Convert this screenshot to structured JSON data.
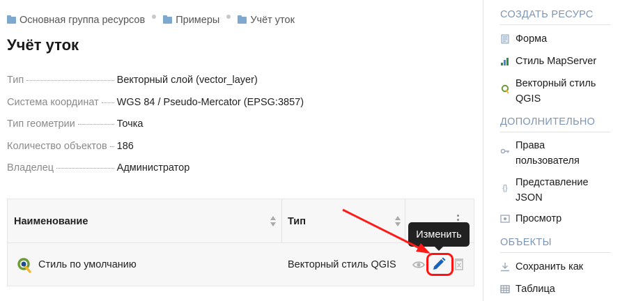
{
  "breadcrumb": [
    {
      "label": "Основная группа ресурсов"
    },
    {
      "label": "Примеры"
    },
    {
      "label": "Учёт уток"
    }
  ],
  "page_title": "Учёт уток",
  "properties": [
    {
      "key": "Тип",
      "value": "Векторный слой (vector_layer)"
    },
    {
      "key": "Система координат",
      "value": "WGS 84 / Pseudo-Mercator (EPSG:3857)"
    },
    {
      "key": "Тип геометрии",
      "value": "Точка"
    },
    {
      "key": "Количество объектов",
      "value": "186"
    },
    {
      "key": "Владелец",
      "value": "Администратор"
    }
  ],
  "table": {
    "columns": [
      {
        "label": "Наименование"
      },
      {
        "label": "Тип"
      }
    ],
    "rows": [
      {
        "name": "Стиль по умолчанию",
        "type": "Векторный стиль QGIS"
      }
    ]
  },
  "tooltip": "Изменить",
  "sidebar": {
    "sections": [
      {
        "title": "СОЗДАТЬ РЕСУРС",
        "items": [
          {
            "label": "Форма",
            "icon": "form-icon"
          },
          {
            "label": "Стиль MapServer",
            "icon": "mapserver-icon"
          },
          {
            "label": "Векторный стиль QGIS",
            "icon": "qgis-icon"
          }
        ]
      },
      {
        "title": "ДОПОЛНИТЕЛЬНО",
        "items": [
          {
            "label": "Права пользователя",
            "icon": "key-icon"
          },
          {
            "label": "Представление JSON",
            "icon": "json-icon"
          },
          {
            "label": "Просмотр",
            "icon": "preview-icon"
          }
        ]
      },
      {
        "title": "ОБЪЕКТЫ",
        "items": [
          {
            "label": "Сохранить как",
            "icon": "download-icon"
          },
          {
            "label": "Таблица",
            "icon": "table-icon"
          }
        ]
      }
    ]
  },
  "colors": {
    "accent": "#1565c0",
    "highlight": "#ff1212",
    "section_heading": "#7d95b4",
    "tooltip_bg": "#212121"
  }
}
